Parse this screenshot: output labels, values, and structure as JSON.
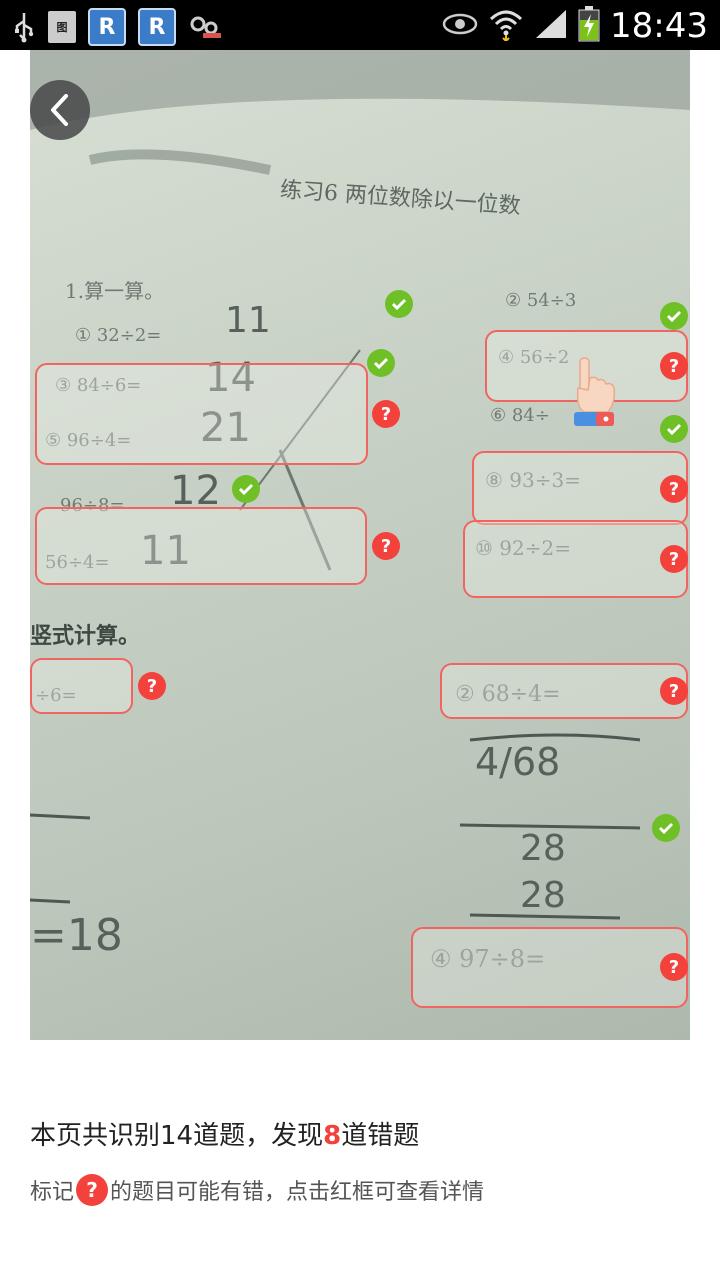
{
  "status_bar": {
    "time": "18:43",
    "left_icons": [
      "usb-icon",
      "document-icon",
      "r-app-icon",
      "r-app-icon",
      "gears-icon"
    ],
    "doc_label": "图",
    "r_label": "R"
  },
  "photo": {
    "worksheet_title": "练习6  两位数除以一位数",
    "section1": "1.算一算。",
    "section2": "竖式计算。",
    "problems": {
      "p1": "① 32÷2=",
      "p1_ans": "11",
      "p3": "③ 84÷6=",
      "p3_ans": "14",
      "p5": "⑤ 96÷4=",
      "p5_ans": "21",
      "p7": "96÷8=",
      "p7_ans": "12",
      "p9": "56÷4=",
      "p9_ans": "11",
      "p2": "② 54÷3",
      "p4": "④ 56÷2",
      "p6": "⑥ 84÷",
      "p8": "⑧ 93÷3=",
      "p10": "⑩ 92÷2=",
      "v1": "÷6=",
      "v2": "② 68÷4=",
      "v4": "④ 97÷8="
    }
  },
  "summary": {
    "prefix": "本页共识别14道题，发现",
    "error_count": "8",
    "suffix": "道错题"
  },
  "hint": {
    "prefix": "标记",
    "icon_text": "?",
    "suffix": "的题目可能有错，点击红框可查看详情"
  },
  "colors": {
    "error_red": "#f3413c",
    "correct_green": "#6fbf26",
    "box_border": "#f0655f"
  }
}
